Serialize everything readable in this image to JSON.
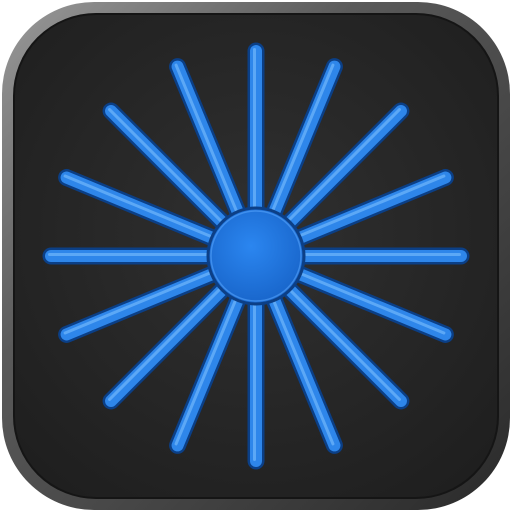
{
  "icon": {
    "name": "starburst-app-icon",
    "ray_count": 16,
    "colors": {
      "bezel_light": "#8c8c8c",
      "bezel_dark": "#3a3a3a",
      "tile_inner": "#2b2b2b",
      "tile_edge": "#1d1d1d",
      "ray_fill": "#2e86ea",
      "ray_highlight": "#7cc0ff",
      "ray_outline": "#0b3f86",
      "core_fill": "#1f6fd6"
    }
  }
}
